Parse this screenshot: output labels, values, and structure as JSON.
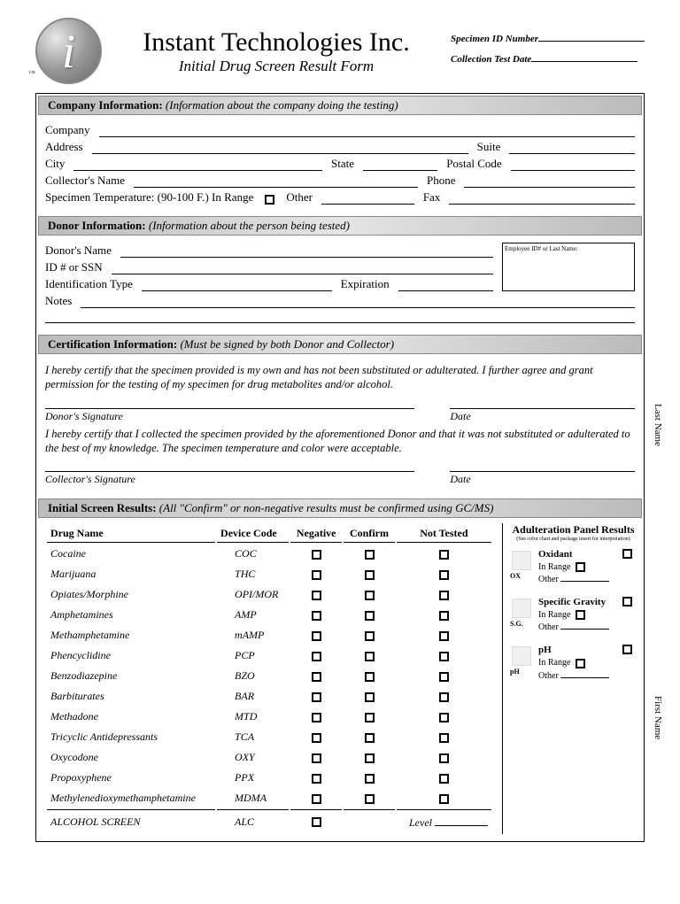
{
  "header": {
    "company": "Instant Technologies Inc.",
    "subtitle": "Initial Drug Screen Result Form",
    "specimen_id_label": "Specimen ID Number",
    "collection_date_label": "Collection Test Date",
    "logo_tm": "™"
  },
  "sections": {
    "company": {
      "title": "Company Information:",
      "hint": "(Information about the company doing the testing)",
      "fields": {
        "company": "Company",
        "address": "Address",
        "suite": "Suite",
        "city": "City",
        "state": "State",
        "postal": "Postal Code",
        "collector": "Collector's Name",
        "phone": "Phone",
        "temp": "Specimen Temperature: (90-100 F.) In Range",
        "other": "Other",
        "fax": "Fax"
      }
    },
    "donor": {
      "title": "Donor Information:",
      "hint": "(Information about the person being tested)",
      "box_label": "Employee ID# or Last Name:",
      "fields": {
        "name": "Donor's Name",
        "id": "ID # or SSN",
        "idtype": "Identification Type",
        "expiration": "Expiration",
        "notes": "Notes"
      }
    },
    "cert": {
      "title": "Certification Information:",
      "hint": "(Must be signed by both Donor and Collector)",
      "donor_text": "I hereby certify that the specimen provided is my own and has not been substituted or adulterated. I further agree and grant permission for the testing of my specimen for drug metabolites and/or alcohol.",
      "donor_sig": "Donor's Signature",
      "date": "Date",
      "collector_text": "I hereby certify that I collected the specimen provided by the aforementioned Donor and that it was not substituted or adulterated to the best of my knowledge. The specimen temperature and color were acceptable.",
      "collector_sig": "Collector's Signature"
    },
    "results": {
      "title": "Initial Screen Results:",
      "hint": "(All \"Confirm\" or non-negative results must be confirmed using GC/MS)",
      "columns": {
        "drug": "Drug Name",
        "code": "Device Code",
        "neg": "Negative",
        "conf": "Confirm",
        "nt": "Not Tested"
      },
      "drugs": [
        {
          "name": "Cocaine",
          "code": "COC"
        },
        {
          "name": "Marijuana",
          "code": "THC"
        },
        {
          "name": "Opiates/Morphine",
          "code": "OPI/MOR"
        },
        {
          "name": "Amphetamines",
          "code": "AMP"
        },
        {
          "name": "Methamphetamine",
          "code": "mAMP"
        },
        {
          "name": "Phencyclidine",
          "code": "PCP"
        },
        {
          "name": "Benzodiazepine",
          "code": "BZO"
        },
        {
          "name": "Barbiturates",
          "code": "BAR"
        },
        {
          "name": "Methadone",
          "code": "MTD"
        },
        {
          "name": "Tricyclic Antidepressants",
          "code": "TCA"
        },
        {
          "name": "Oxycodone",
          "code": "OXY"
        },
        {
          "name": "Propoxyphene",
          "code": "PPX"
        },
        {
          "name": "Methylenedioxymethamphetamine",
          "code": "MDMA"
        }
      ],
      "alcohol": {
        "name": "ALCOHOL SCREEN",
        "code": "ALC",
        "level": "Level"
      }
    },
    "adult": {
      "title": "Adulteration Panel Results",
      "sub": "(See color chart and package insert for interpretation)",
      "items": [
        {
          "name": "Oxidant",
          "abbr": "OX",
          "range": "In Range",
          "other": "Other"
        },
        {
          "name": "Specific Gravity",
          "abbr": "S.G.",
          "range": "In Range",
          "other": "Other"
        },
        {
          "name": "pH",
          "abbr": "pH",
          "range": "In Range",
          "other": "Other"
        }
      ]
    }
  },
  "side": {
    "last": "Last Name",
    "first": "First Name"
  }
}
